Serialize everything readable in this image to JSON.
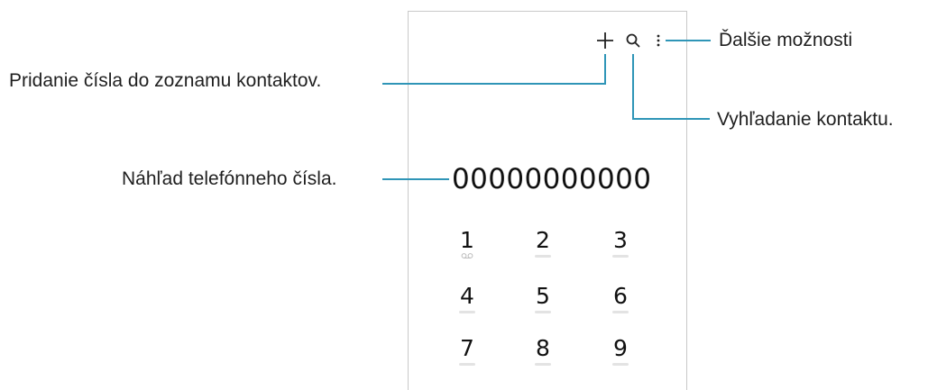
{
  "callouts": {
    "add_contact": "Pridanie čísla do zoznamu kontaktov.",
    "more_options": "Ďalšie možnosti",
    "search_contact": "Vyhľadanie kontaktu.",
    "number_preview": "Náhľad telefónneho čísla."
  },
  "dialer": {
    "number": "00000000000",
    "keys": [
      "1",
      "2",
      "3",
      "4",
      "5",
      "6",
      "7",
      "8",
      "9"
    ]
  },
  "icons": {
    "add": "plus-icon",
    "search": "search-icon",
    "more": "more-vertical-icon",
    "voicemail": "voicemail-icon"
  },
  "colors": {
    "callout_line": "#2f95b7",
    "frame_border": "#c9c9c9"
  }
}
